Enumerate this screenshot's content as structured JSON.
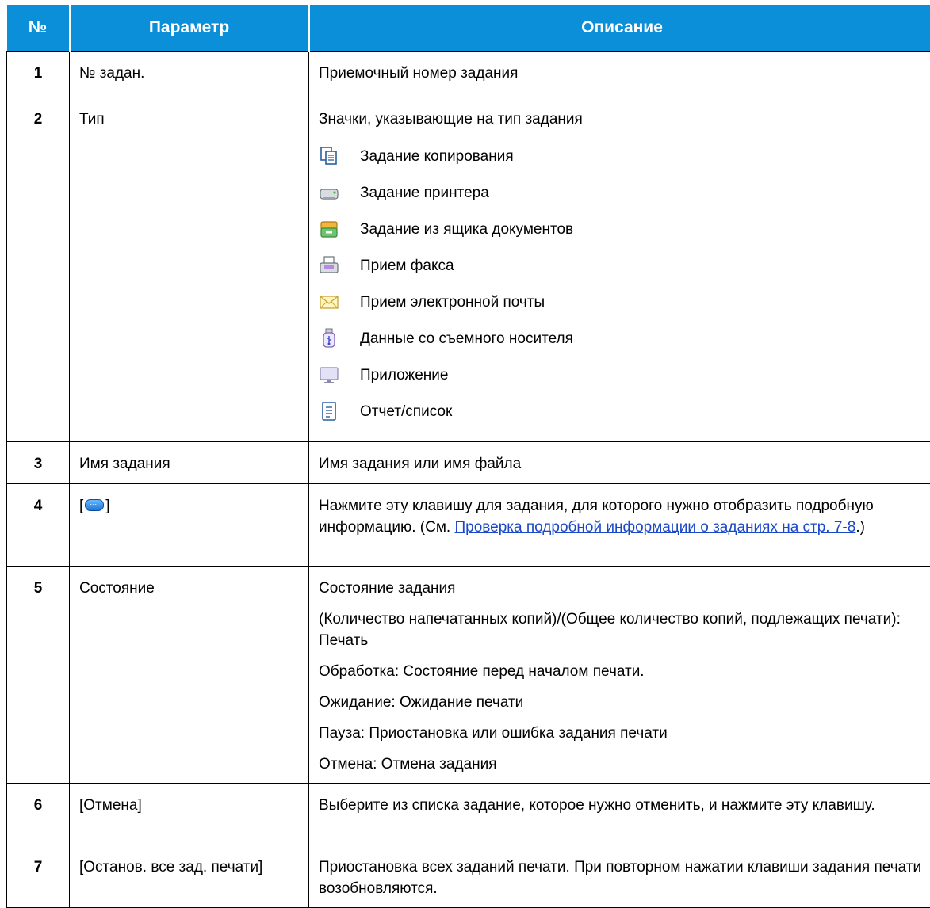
{
  "header": {
    "col_num": "№",
    "col_param": "Параметр",
    "col_desc": "Описание"
  },
  "rows": [
    {
      "num": "1",
      "param": "№ задан.",
      "desc": "Приемочный номер задания"
    },
    {
      "num": "2",
      "param": "Тип",
      "desc": "Значки, указывающие на тип задания",
      "types": [
        {
          "icon": "copy-job-icon",
          "label": "Задание копирования"
        },
        {
          "icon": "printer-job-icon",
          "label": "Задание принтера"
        },
        {
          "icon": "document-box-icon",
          "label": "Задание из ящика документов"
        },
        {
          "icon": "fax-icon",
          "label": "Прием факса"
        },
        {
          "icon": "email-icon",
          "label": "Прием электронной почты"
        },
        {
          "icon": "usb-media-icon",
          "label": "Данные со съемного носителя"
        },
        {
          "icon": "application-icon",
          "label": "Приложение"
        },
        {
          "icon": "report-list-icon",
          "label": "Отчет/список"
        }
      ]
    },
    {
      "num": "3",
      "param": "Имя задания",
      "desc": "Имя задания или имя файла"
    },
    {
      "num": "4",
      "param_prefix": "[",
      "param_suffix": "]",
      "desc_before": "Нажмите эту клавишу для задания, для которого нужно отобразить подробную информацию. (См. ",
      "desc_link": "Проверка подробной информации о заданиях на стр. 7-8",
      "desc_after": ".)"
    },
    {
      "num": "5",
      "param": "Состояние",
      "paras": [
        "Состояние задания",
        "(Количество напечатанных копий)/(Общее количество копий, подлежащих печати): Печать",
        "Обработка: Состояние перед началом печати.",
        "Ожидание: Ожидание печати",
        "Пауза: Приостановка или ошибка задания печати",
        "Отмена: Отмена задания"
      ]
    },
    {
      "num": "6",
      "param": "[Отмена]",
      "desc": "Выберите из списка задание, которое нужно отменить, и нажмите эту клавишу."
    },
    {
      "num": "7",
      "param": "[Останов. все зад. печати]",
      "desc": "Приостановка всех заданий печати. При повторном нажатии клавиши задания печати возобновляются."
    }
  ]
}
